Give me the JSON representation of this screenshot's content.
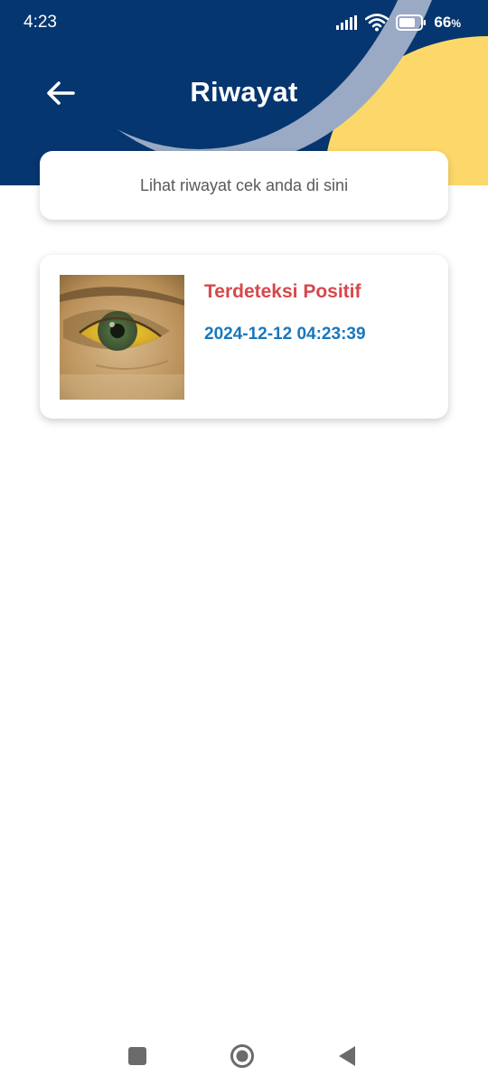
{
  "status_bar": {
    "time": "4:23",
    "battery_level": "66",
    "battery_unit": "%"
  },
  "header": {
    "title": "Riwayat",
    "back_icon": "arrow-left-icon"
  },
  "subtitle": {
    "text": "Lihat riwayat cek anda di sini"
  },
  "history": [
    {
      "status": "Terdeteksi Positif",
      "datetime": "2024-12-12 04:23:39",
      "thumbnail": "eye-photo"
    }
  ],
  "colors": {
    "header_navy": "#063670",
    "accent_yellow": "#fcd86a",
    "status_positive": "#d7474b",
    "date_blue": "#1877bd"
  },
  "nav_bar": {
    "icons": [
      "square-icon",
      "home-circle-icon",
      "back-triangle-icon"
    ]
  }
}
